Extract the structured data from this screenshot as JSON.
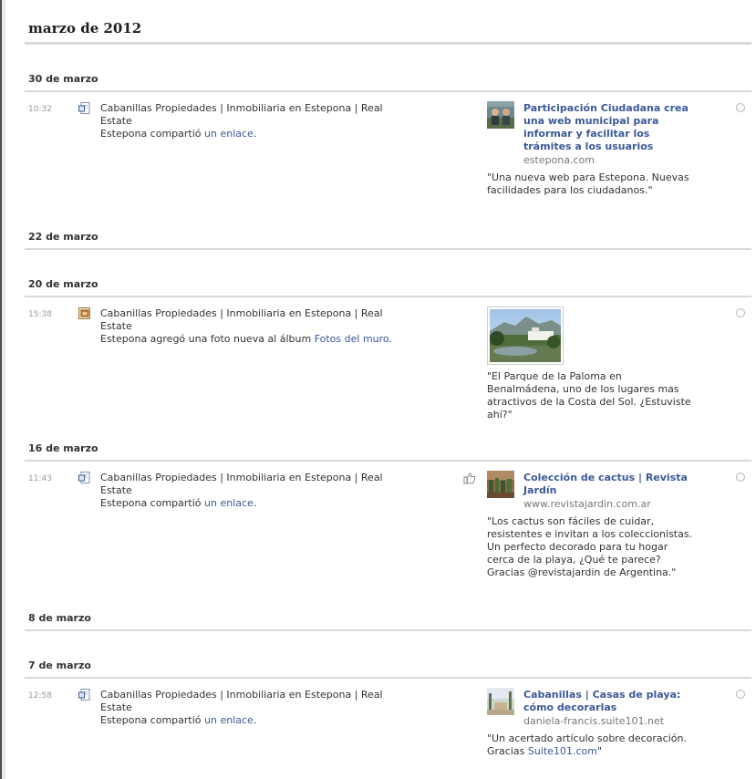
{
  "month_title": "marzo de 2012",
  "days": [
    {
      "label": "30 de marzo"
    },
    {
      "label": "22 de marzo"
    },
    {
      "label": "20 de marzo"
    },
    {
      "label": "16 de marzo"
    },
    {
      "label": "8 de marzo"
    },
    {
      "label": "7 de marzo"
    }
  ],
  "posts": [
    {
      "time": "10:32",
      "icon": "link-share-icon",
      "line1": "Cabanillas Propiedades | Inmobiliaria en Estepona | Real Estate",
      "line2_prefix": "Estepona compartió ",
      "line2_link": "un enlace",
      "line2_suffix": ".",
      "link_title": "Participación Ciudadana crea una web municipal para informar y facilitar los trámites a los usuarios",
      "link_domain": "estepona.com",
      "quote": "\"Una nueva web para Estepona. Nuevas facilidades para los ciudadanos.\""
    },
    {
      "time": "15:38",
      "icon": "photo-album-icon",
      "line1": "Cabanillas Propiedades | Inmobiliaria en Estepona | Real Estate",
      "line2_prefix": "Estepona agregó una foto nueva al álbum ",
      "line2_link": "Fotos del muro",
      "line2_suffix": ".",
      "quote": "\"El Parque de la Paloma en Benalmádena, uno de los lugares mas atractivos de la Costa del Sol. ¿Estuviste ahí?\""
    },
    {
      "time": "11:43",
      "icon": "link-share-icon",
      "line1": "Cabanillas Propiedades | Inmobiliaria en Estepona | Real Estate",
      "line2_prefix": "Estepona compartió ",
      "line2_link": "un enlace",
      "line2_suffix": ".",
      "link_title": "Colección de cactus | Revista Jardín",
      "link_domain": "www.revistajardin.com.ar",
      "quote": "\"Los cactus son fáciles de cuidar, resistentes e invitan a los coleccionistas. Un perfecto decorado para tu hogar cerca de la playa, ¿Qué te parece? Gracias @revistajardin de Argentina.\""
    },
    {
      "time": "12:58",
      "icon": "link-share-icon",
      "line1": "Cabanillas Propiedades | Inmobiliaria en Estepona | Real Estate",
      "line2_prefix": "Estepona compartió ",
      "line2_link": "un enlace",
      "line2_suffix": ".",
      "link_title": "Cabanillas | Casas de playa: cómo decorarlas",
      "link_domain": "daniela-francis.suite101.net",
      "quote_prefix": "\"Un acertado artículo sobre decoración. Gracias ",
      "quote_link": "Suite101.com",
      "quote_suffix": "\""
    }
  ]
}
